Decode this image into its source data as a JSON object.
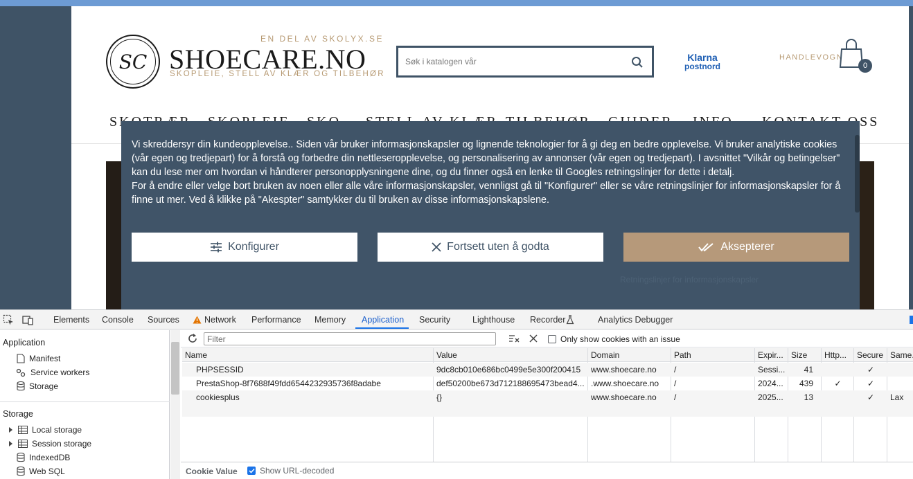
{
  "site": {
    "logo_mark": "SC",
    "logo_tagline": "EN DEL AV SKOLYX.SE",
    "logo_name": "SHOECARE.NO",
    "logo_subtitle": "SKOPLEIE, STELL AV KLÆR OG TILBEHØR",
    "search_placeholder": "Søk i katalogen vår",
    "payment_logo_1": "Klarna",
    "payment_logo_2": "postnord",
    "cart_label": "HANDLEVOGN",
    "cart_count": "0",
    "nav_items": [
      "SKOTRÆR",
      "SKOPLEIE",
      "SKO",
      "STELL AV KLÆR",
      "TILBEHØR",
      "GUIDER",
      "INFO",
      "KONTAKT OSS"
    ]
  },
  "cookie_banner": {
    "paragraph_1": "Vi skreddersyr din kundeopplevelse.. Siden vår bruker informasjonskapsler og lignende teknologier for å gi deg en bedre opplevelse. Vi bruker analytiske cookies (vår egen og tredjepart) for å forstå og forbedre din nettleseropplevelse, og personalisering av annonser (vår egen og tredjepart). I avsnittet \"Vilkår og betingelser\" kan du lese mer om hvordan vi håndterer personopplysningene dine, og du finner også en lenke til Googles retningslinjer for dette i detalj.",
    "paragraph_2": "For å endre eller velge bort bruken av noen eller alle våre informasjonskapsler, vennligst gå til \"Konfigurer\" eller se våre retningslinjer for informasjonskapsler for å finne ut mer. Ved å klikke på \"Akespter\" samtykker du til bruken av disse informasjonskapslene.",
    "configure_label": "Konfigurer",
    "continue_label": "Fortsett uten å godta",
    "accept_label": "Aksepterer",
    "faint_link": "Retningslinjer for informasjonskapsler"
  },
  "devtools": {
    "tabs": [
      "Elements",
      "Console",
      "Sources",
      "Network",
      "Performance",
      "Memory",
      "Application",
      "Security",
      "Lighthouse",
      "Recorder",
      "Analytics Debugger"
    ],
    "active_tab": "Application",
    "sidebar": {
      "application_heading": "Application",
      "application_items": [
        "Manifest",
        "Service workers",
        "Storage"
      ],
      "storage_heading": "Storage",
      "storage_items": [
        "Local storage",
        "Session storage",
        "IndexedDB",
        "Web SQL"
      ]
    },
    "filter_placeholder": "Filter",
    "only_issue_label": "Only show cookies with an issue",
    "columns": [
      "Name",
      "Value",
      "Domain",
      "Path",
      "Expir...",
      "Size",
      "Http...",
      "Secure",
      "Same..."
    ],
    "rows": [
      {
        "name": "PHPSESSID",
        "value": "9dc8cb010e686bc0499e5e300f200415",
        "domain": "www.shoecare.no",
        "path": "/",
        "expires": "Sessi...",
        "size": "41",
        "http": "",
        "secure": "✓",
        "same": ""
      },
      {
        "name": "PrestaShop-8f7688f49fdd6544232935736f8adabe",
        "value": "def50200be673d712188695473bead4...",
        "domain": ".www.shoecare.no",
        "path": "/",
        "expires": "2024...",
        "size": "439",
        "http": "✓",
        "secure": "✓",
        "same": ""
      },
      {
        "name": "cookiesplus",
        "value": "{}",
        "domain": "www.shoecare.no",
        "path": "/",
        "expires": "2025...",
        "size": "13",
        "http": "",
        "secure": "✓",
        "same": "Lax"
      }
    ],
    "cookie_value_label": "Cookie Value",
    "show_decoded_label": "Show URL-decoded",
    "colors": {
      "accent": "#1a73e8",
      "warning": "#e37400"
    }
  }
}
